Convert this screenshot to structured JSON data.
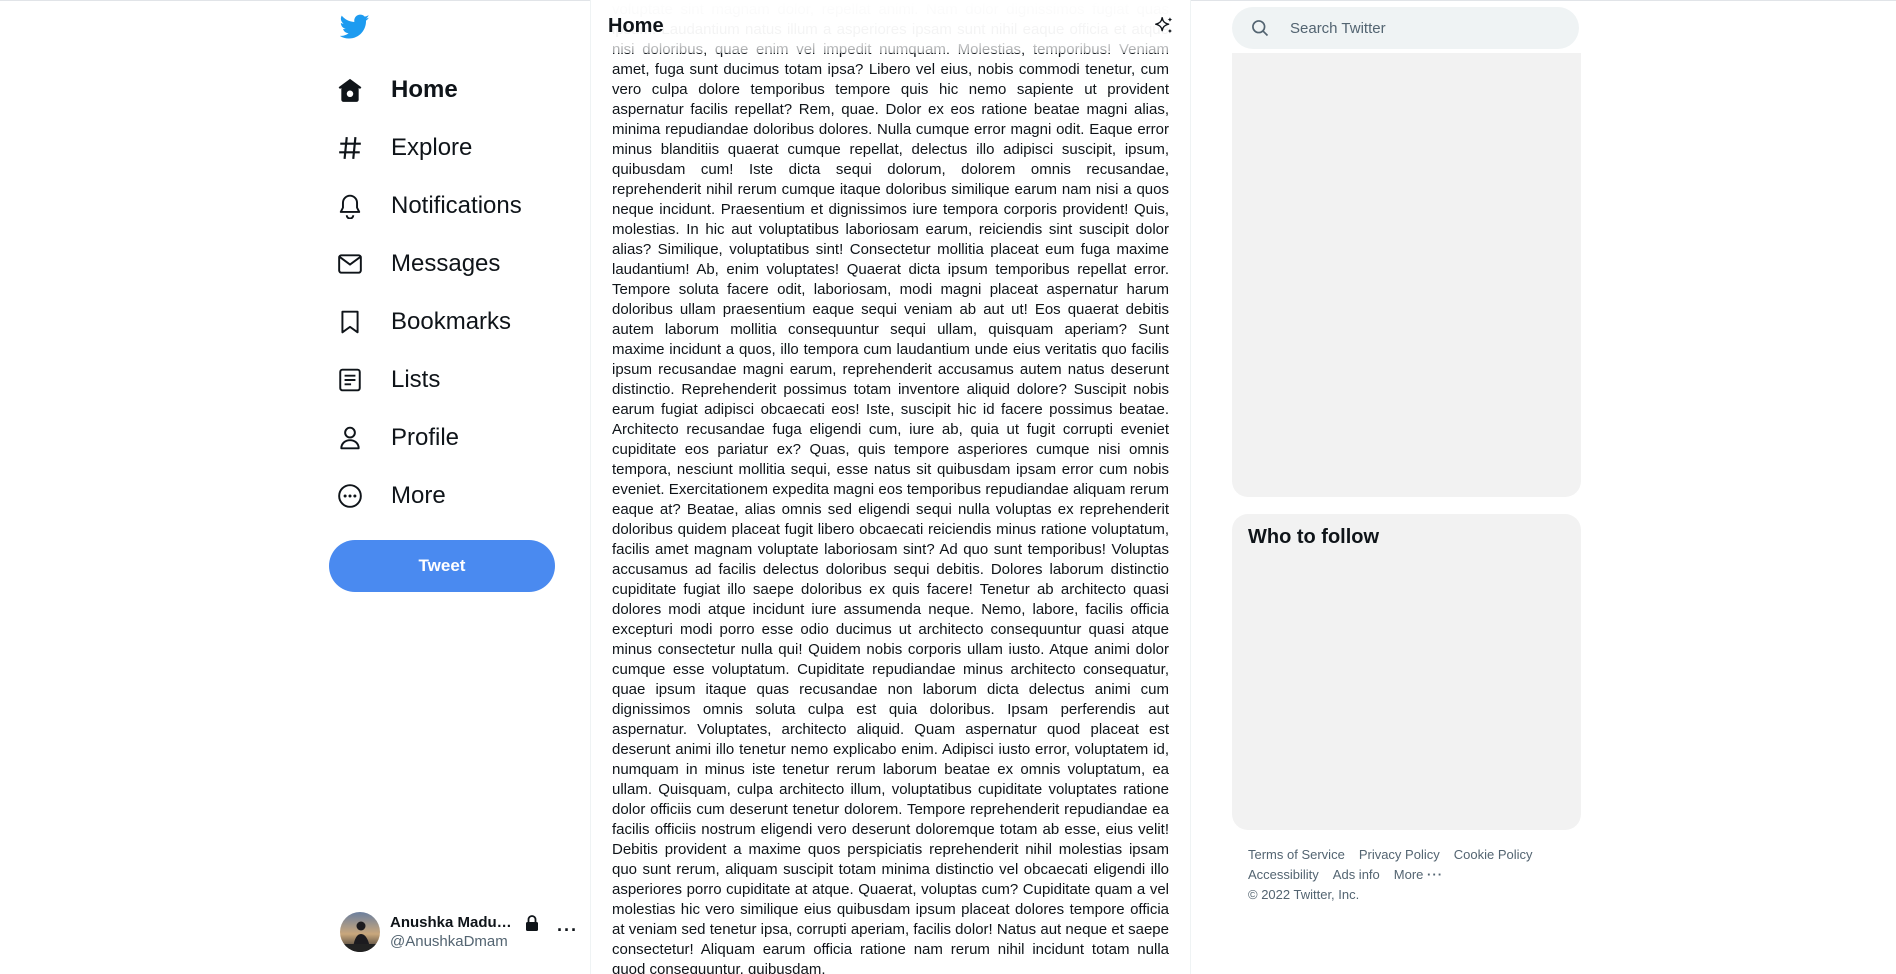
{
  "colors": {
    "brand": "#1d9bf0",
    "tweet_button": "#4a8af0",
    "panel": "#f2f2f2"
  },
  "sidebar": {
    "logo_icon": "twitter-bird-icon",
    "items": [
      {
        "label": "Home",
        "icon": "home-icon"
      },
      {
        "label": "Explore",
        "icon": "hashtag-icon"
      },
      {
        "label": "Notifications",
        "icon": "bell-icon"
      },
      {
        "label": "Messages",
        "icon": "envelope-icon"
      },
      {
        "label": "Bookmarks",
        "icon": "bookmark-icon"
      },
      {
        "label": "Lists",
        "icon": "list-icon"
      },
      {
        "label": "Profile",
        "icon": "person-icon"
      },
      {
        "label": "More",
        "icon": "more-circle-icon"
      }
    ],
    "tweet_label": "Tweet",
    "account": {
      "name": "Anushka Madu…",
      "handle": "@AnushkaDmam",
      "more": "···"
    }
  },
  "main": {
    "title": "Home",
    "body_text": "Lorem ipsum dolor sit amet consectetur adipisicing elit. Quaerat, quidem veritatis voluptate sint magnam dolor, repellat animi. Nam dolor dignissimos fugiat quas ipsum. Laudantium natus illum a asperiores ipsam sunt nihil eaque officia et atque nisi doloribus, quae enim vel impedit numquam. Molestias, temporibus! Veniam amet, fuga sunt ducimus totam ipsa? Libero vel eius, nobis commodi tenetur, cum vero culpa dolore temporibus tempore quis hic nemo sapiente ut provident aspernatur facilis repellat? Rem, quae. Dolor ex eos ratione beatae magni alias, minima repudiandae doloribus dolores. Nulla cumque error magni odit. Eaque error minus blanditiis quaerat cumque repellat, delectus illo adipisci suscipit, ipsum, quibusdam cum! Iste dicta sequi dolorum, dolorem omnis recusandae, reprehenderit nihil rerum cumque itaque doloribus similique earum nam nisi a quos neque incidunt. Praesentium et dignissimos iure tempora corporis provident! Quis, molestias. In hic aut voluptatibus laboriosam earum, reiciendis sint suscipit dolor alias? Similique, voluptatibus sint! Consectetur mollitia placeat eum fuga maxime laudantium! Ab, enim voluptates! Quaerat dicta ipsum temporibus repellat error. Tempore soluta facere odit, laboriosam, modi magni placeat aspernatur harum doloribus ullam praesentium eaque sequi veniam ab aut ut! Eos quaerat debitis autem laborum mollitia consequuntur sequi ullam, quisquam aperiam? Sunt maxime incidunt a quos, illo tempora cum laudantium unde eius veritatis quo facilis ipsum recusandae magni earum, reprehenderit accusamus autem natus deserunt distinctio. Reprehenderit possimus totam inventore aliquid dolore? Suscipit nobis earum fugiat adipisci obcaecati eos! Iste, suscipit hic id facere possimus beatae. Architecto recusandae fuga eligendi cum, iure ab, quia ut fugit corrupti eveniet cupiditate eos pariatur ex? Quas, quis tempore asperiores cumque nisi omnis tempora, nesciunt mollitia sequi, esse natus sit quibusdam ipsam error cum nobis eveniet. Exercitationem expedita magni eos temporibus repudiandae aliquam rerum eaque at? Beatae, alias omnis sed eligendi sequi nulla voluptas ex reprehenderit doloribus quidem placeat fugit libero obcaecati reiciendis minus ratione voluptatum, facilis amet magnam voluptate laboriosam sint? Ad quo sunt temporibus! Voluptas accusamus ad facilis delectus doloribus sequi debitis. Dolores laborum distinctio cupiditate fugiat illo saepe doloribus ex quis facere! Tenetur ab architecto quasi dolores modi atque incidunt iure assumenda neque. Nemo, labore, facilis officia excepturi modi porro esse odio ducimus ut architecto consequuntur quasi atque minus consectetur nulla qui! Quidem nobis corporis ullam iusto. Atque animi dolor cumque esse voluptatum. Cupiditate repudiandae minus architecto consequatur, quae ipsum itaque quas recusandae non laborum dicta delectus animi cum dignissimos omnis soluta culpa est quia doloribus. Ipsam perferendis aut aspernatur. Voluptates, architecto aliquid. Quam aspernatur quod placeat est deserunt animi illo tenetur nemo explicabo enim. Adipisci iusto error, voluptatem id, numquam in minus iste tenetur rerum laborum beatae ex omnis voluptatum, ea ullam. Quisquam, culpa architecto illum, voluptatibus cupiditate voluptates ratione dolor officiis cum deserunt tenetur dolorem. Tempore reprehenderit repudiandae ea facilis officiis nostrum eligendi vero deserunt doloremque totam ab esse, eius velit! Debitis provident a maxime quos perspiciatis reprehenderit nihil molestias ipsam quo sunt rerum, aliquam suscipit totam minima distinctio vel obcaecati eligendi illo asperiores porro cupiditate at atque. Quaerat, voluptas cum? Cupiditate quam a vel molestias hic vero similique eius quibusdam ipsum placeat dolores tempore officia at veniam sed tenetur ipsa, corrupti aperiam, facilis dolor! Natus aut neque et saepe consectetur! Aliquam earum officia ratione nam rerum nihil incidunt totam nulla quod consequuntur, quibusdam."
  },
  "right": {
    "search_placeholder": "Search Twitter",
    "who_to_follow": "Who to follow",
    "footer_links": [
      "Terms of Service",
      "Privacy Policy",
      "Cookie Policy",
      "Accessibility",
      "Ads info",
      "More"
    ],
    "more_dots": "···",
    "copyright": "© 2022 Twitter, Inc."
  }
}
